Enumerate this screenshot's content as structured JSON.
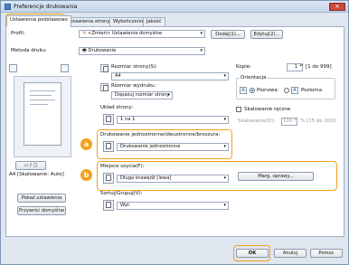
{
  "window": {
    "title": "Preferencje drukowania"
  },
  "tabs": [
    {
      "label": "Ustawienia podstawowe"
    },
    {
      "label": "stawienia strony"
    },
    {
      "label": "Wykończenie"
    },
    {
      "label": "Jakość"
    }
  ],
  "profile": {
    "label": "Profil:",
    "value": "<Zmień> Ustawienia domyślne",
    "add": "Dodaj(1)...",
    "edit": "Edytuj(2)..."
  },
  "method": {
    "label": "Metoda druku:",
    "value": "Drukowanie"
  },
  "page_size": {
    "label": "Rozmiar strony(S):",
    "value": "A4"
  },
  "output_size": {
    "label": "Rozmiar wydruku:",
    "value": "Dopasuj rozmiar strony"
  },
  "layout": {
    "label": "Układ strony:",
    "value": "1 na 1"
  },
  "copies": {
    "label": "Kopie:",
    "value": "1",
    "range": "[1 do 999]"
  },
  "orientation": {
    "label": "Orientacja",
    "portrait": "Pionowa",
    "landscape": "Pozioma"
  },
  "manual_scaling": {
    "label": "Skalowanie ręczne",
    "scale_label": "Skalowanie(D):",
    "scale_value": "100",
    "scale_range": "% [25 do 200]"
  },
  "duplex": {
    "label": "Drukowanie jednostronne/dwustronne/broszura:",
    "value": "Drukowanie jednostronne",
    "badge": "a"
  },
  "binding": {
    "label": "Miejsce szycia(F):",
    "value": "Długa krawędź [lewa]",
    "margin_btn": "Marg. oprawy...",
    "badge": "b"
  },
  "collate": {
    "label": "Sortuj/Grupuj(V):",
    "value": "Wył."
  },
  "preview": {
    "caption": "A4 [Skalowanie: Auto]"
  },
  "left_buttons": {
    "show_settings": "Pokaż ustawienia",
    "restore": "Przywróć domyślne"
  },
  "footer": {
    "ok": "OK",
    "cancel": "Anuluj",
    "help": "Pomoc"
  }
}
